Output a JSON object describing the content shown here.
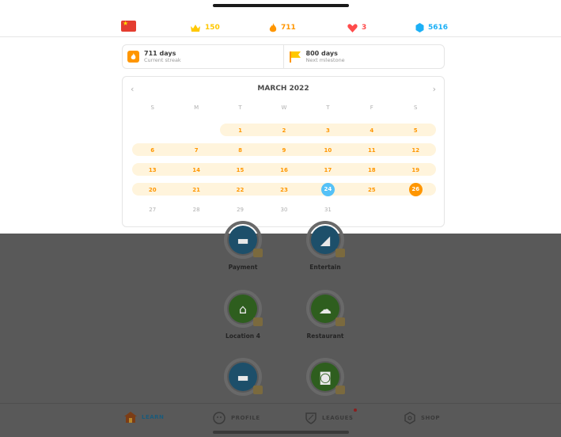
{
  "topbar": {
    "crowns": "150",
    "streak": "711",
    "hearts": "3",
    "gems": "5616",
    "colors": {
      "crown": "#ffc800",
      "streak": "#ff9600",
      "heart": "#ff4b4b",
      "gem": "#1cb0f6"
    }
  },
  "streak_info": {
    "current_days": "711 days",
    "current_label": "Current streak",
    "milestone_days": "800 days",
    "milestone_label": "Next milestone"
  },
  "calendar": {
    "month_title": "MARCH 2022",
    "weekdays": [
      "S",
      "M",
      "T",
      "W",
      "T",
      "F",
      "S"
    ],
    "weeks": [
      [
        "",
        "",
        "1",
        "2",
        "3",
        "4",
        "5"
      ],
      [
        "6",
        "7",
        "8",
        "9",
        "10",
        "11",
        "12"
      ],
      [
        "13",
        "14",
        "15",
        "16",
        "17",
        "18",
        "19"
      ],
      [
        "20",
        "21",
        "22",
        "23",
        "24",
        "25",
        "26"
      ],
      [
        "27",
        "28",
        "29",
        "30",
        "31",
        "",
        ""
      ]
    ],
    "streak_color": "#ff9600",
    "today": "26",
    "freeze_day": "24"
  },
  "skills": [
    {
      "name": "Payment",
      "icon": "hat-icon"
    },
    {
      "name": "Entertain",
      "icon": "shoe-icon"
    },
    {
      "name": "Location 4",
      "icon": "bank-icon"
    },
    {
      "name": "Restaurant",
      "icon": "chef-hat-icon"
    },
    {
      "name": "",
      "icon": "hat-icon"
    },
    {
      "name": "",
      "icon": "camera-icon"
    }
  ],
  "nav": {
    "learn": "LEARN",
    "profile": "PROFILE",
    "leagues": "LEAGUES",
    "shop": "SHOP"
  }
}
